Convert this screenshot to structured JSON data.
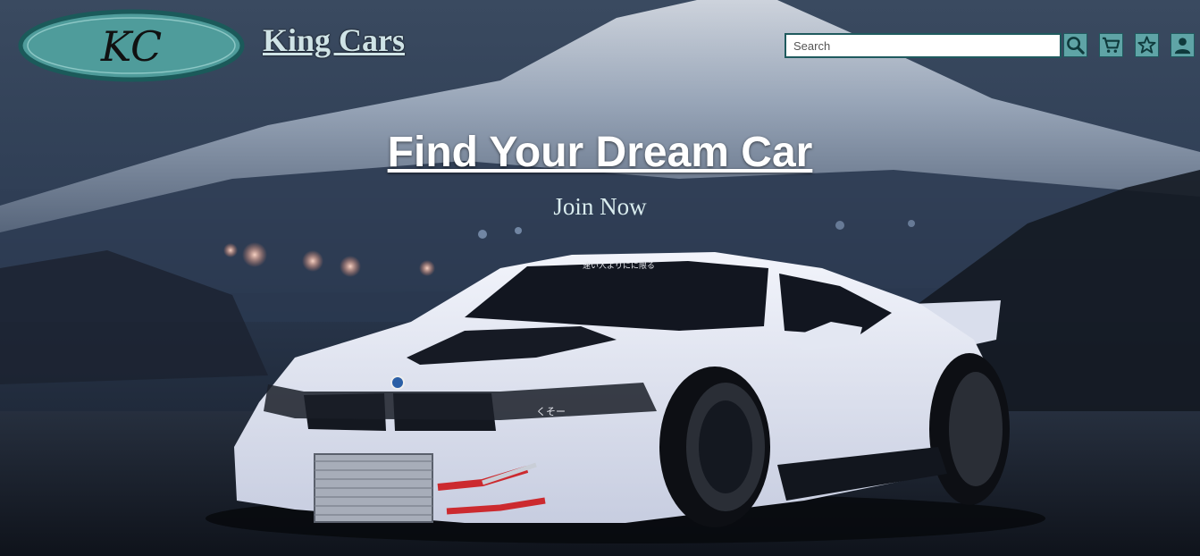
{
  "logo": {
    "monogram": "KC",
    "colors": {
      "fill": "#4f9c9b",
      "border": "#1b5a5a"
    }
  },
  "header": {
    "brand_name": "King Cars"
  },
  "search": {
    "placeholder": "Search"
  },
  "icons": [
    "search-icon",
    "cart-icon",
    "star-icon",
    "user-icon"
  ],
  "hero": {
    "headline": "Find Your Dream Car",
    "cta": "Join Now",
    "car_windshield_text": "速い人よりにに限る",
    "car_bumper_text": "くそー"
  },
  "colors": {
    "accent": "#5fa4a6",
    "brand_text": "#cfe3e6",
    "car_body": "#dfe4f2"
  }
}
